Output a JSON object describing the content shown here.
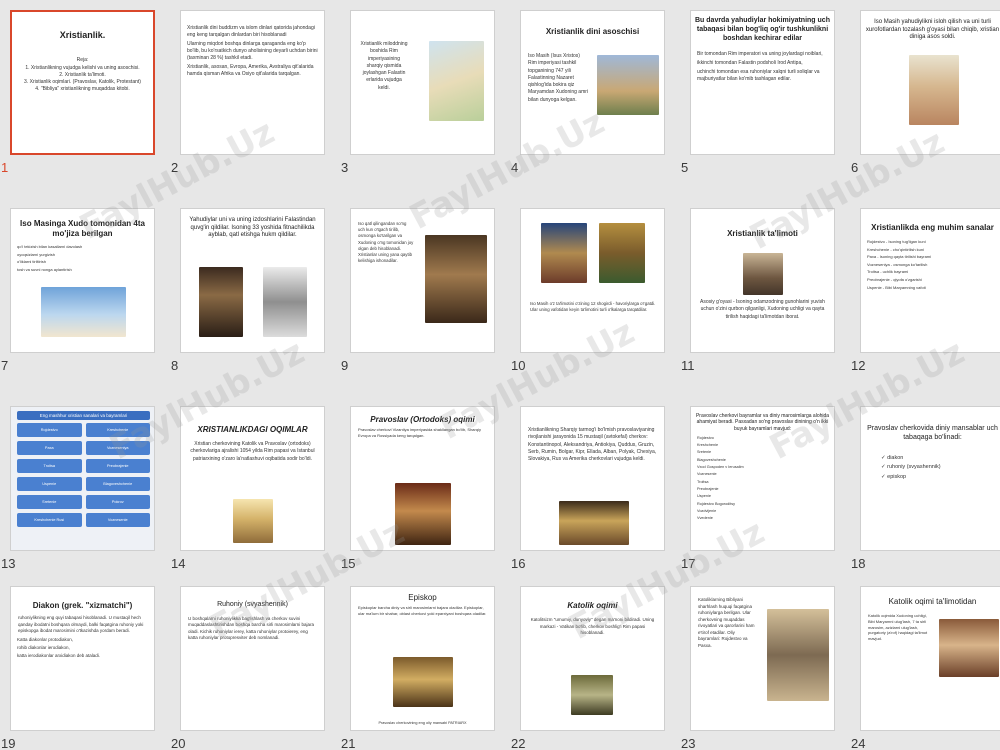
{
  "watermark": "FaylHub.Uz",
  "slides": [
    {
      "num": "1",
      "title": "Xristianlik.",
      "text": "Reja:\n1. Xristianlikning vujudga kelishi va uning asoschisi.\n2. Xristianlik ta'limoti.\n3. Xristianlik oqimlari. (Pravoslav, Katolik, Protestant)\n4. \"Bibliya\" xristianlikning muqaddas kitobi."
    },
    {
      "num": "2",
      "bullets": [
        "Xristianlik dini buddizm va islom dinlari qatorida jahondagi eng keng tarqalgan dinlardan biri hisoblanadi",
        "Ularning miqdori boshqa dinlarga qaraganda eng ko'p bo'lib, bu ko'rsatkich dunyo aholisining deyarli uchdan birini (taxminan 28 %) tashkil etadi.",
        "Xristianlik, asosan, Evropa, Amerika, Avstraliya qit'alarida hamda qisman Afrika va Osiyo qit'alarida tarqalgan."
      ]
    },
    {
      "num": "3",
      "text": "Xristianlik miloddning boshida Rim imperiyasining sharqiy qismida joylashgan Falastin erlarida vujudga keldi."
    },
    {
      "num": "4",
      "title": "Xristianlik dini asoschisi",
      "text": "Iso Masih (Isus Xristos) Rim imperiyasi tashkil topganining 747 yili Falastinning Nazaret qishlog'ida bokira qiz Maryamdan Xudoning amri bilan dunyoga kelgan."
    },
    {
      "num": "5",
      "title": "Bu davrda yahudiylar hokimiyatning uch tabaqasi bilan bog'liq og'ir tushkunlikni boshdan kechirar edilar",
      "bullets": [
        "Bir tomondan Rim imperatori va uning joylardagi noiblari,",
        "ikkinchi tomondan Falastin podsholi Irod Antipa,",
        "uchinchi tomondan esa ruhoniylar xalqni turli soliqlar va majburiyatlar bilan ko'mib tashlagan edilar."
      ]
    },
    {
      "num": "6",
      "title": "Iso Masih yahudiylikni isloh qilish va uni turli xurofotlardan tozalash g'oyasi bilan chiqib, xristian diniga asos soldi."
    },
    {
      "num": "7",
      "title": "Iso Masinga Xudo tomonidan 4ta mo'jiza berilgan",
      "bullets": [
        "qo'l tekizish bilan kasallarni davolash",
        "oyoqsizlarni yurgizish",
        "o'liklarni tiriltirish",
        "tosh va suvni nonga aylantirish"
      ]
    },
    {
      "num": "8",
      "title": "Yahudiylar uni va uning izdoshlarini Falastindan quvg'in qildilar. Isoning 33 yoshida fitnachilikda ayblab, qatl etishga hukm qildilar."
    },
    {
      "num": "9",
      "text": "Iso qatl qilingandan so'ng uch kun o'tgach tirilib, osmonga ko'tarilgan va Xudoning o'ng tomonidan joy olgan deb hisoblanadi. Xristianlar uning yana qaytib kelishiga ishonadilar."
    },
    {
      "num": "10",
      "text": "Iso Masih o'z ta'limotini o'zining 12 shogirdi - havoriylarga o'rgatdi. Ular uning vafotidan keyin ta'limotini turli o'lkalarga tarqatdilar."
    },
    {
      "num": "11",
      "title": "Xristianlik ta'limoti",
      "text": "Asosiy g'oyasi - Isoning odamzodning gunohlarini yuvish uchun o'zini qurbon qilganligi, Xudoning uchligi va qayta tirilish haqidagi ta'limotdan iborat."
    },
    {
      "num": "12",
      "title": "Xristianlikda eng muhim sanalar",
      "bullets": [
        "Rojdestvo - Isoning tug'ilgan kuni",
        "Kreshchenie - cho'qintirilish kuni",
        "Paxa - Isoning qayta tirilishi bayrami",
        "Vozneseniya - osmonga ko'tarilish",
        "Troitsa - uchlik bayrami",
        "Preobrajenie - qiyofa o'zgarishi",
        "Uspenie - Bibi Maryamning vafoti"
      ]
    },
    {
      "num": "13",
      "title": "Eng mashhur xristian sanalari va bayramlari",
      "boxes": [
        "Rojdestvo",
        "Kreshchenie",
        "Paxa",
        "Vozneseniya",
        "Troitsa",
        "Preobrajenie",
        "Uspenie",
        "Blagoveshchenie",
        "Sretenie",
        "Pokrov",
        "Kreshchenie Rusi",
        "Voznesenie"
      ]
    },
    {
      "num": "14",
      "title": "XRISTIANLIKDAGI OQIMLAR",
      "text": "Xristian cherkovining Katolik va Pravoslav (ortodoks) cherkovlariga ajralishi 1054 yilda Rim papasi va Istanbul patriarxining o'zaro la'natlashuvi oqibatida sodir bo'ldi."
    },
    {
      "num": "15",
      "title": "Pravoslav (Ortodoks) oqimi",
      "text": "Pravoslav cherkovi Vizantiya imperiyasida shakllangan bo'lib, Sharqiy Evropa va Rossiyada keng tarqalgan."
    },
    {
      "num": "16",
      "text": "Xristianlikning Sharqiy tarmog'i bo'lmish pravoslaviyaning rivojlanishi jarayonida 15 mustaqil (avtokefal) cherkov: Konstantinopol, Aleksandriya, Antiokiya, Quddus, Gruzin, Serb, Rumin, Bolgar, Kipr, Ellada, Alban, Polyak, Chexiya, Slovakiya, Rus va Amerika cherkovlari vujudga keldi."
    },
    {
      "num": "17",
      "title": "Pravoslav cherkovi bayramlar va diniy marosimlarga alohida ahamiyat beradi. Pasxadan so'ng pravoslav dinining o'n ikki buyuk bayramlari mavjud:",
      "bullets": [
        "Rojdestvo",
        "Kreshchenie",
        "Sretenie",
        "Blagoveshchenie",
        "Vxod Gospoden v Ierusalim",
        "Voznesenie",
        "Troitsa",
        "Preobrajenie",
        "Uspenie",
        "Rojdestvo Bogoroditsy",
        "Vozdvijenie",
        "Vvedenie"
      ]
    },
    {
      "num": "18",
      "title": "Pravoslav cherkovida diniy mansablar uch tabaqaga bo'linadi:",
      "checks": [
        "diakon",
        "ruhoniy (svyashennik)",
        "episkop"
      ]
    },
    {
      "num": "19",
      "title": "Diakon (grek. \"xizmatchi\")",
      "text": "ruhoniylikning eng quyi tabaqasi hisoblanadi. U mustaqil hech qanday ibodatni boshqara olmaydi, balki faqatgina ruhoniy yoki episkopga ibodat marosimini o'tkazishda yordam beradi.",
      "bullets": [
        "Katta diakonlar protodiakon,",
        "rohib diakonlar ierodiakon,",
        "katta ierodiakonlar arxidiakon deb ataladi."
      ]
    },
    {
      "num": "20",
      "title": "Ruhoniy (svyashennik)",
      "text": "U boshqalarni ruhoniylikka bag'ishlash va cherkov suvini muqaddaslashtirishdan boshqa barcha sirli marosimlarni bajara oladi. Kichik ruhoniylar ierey, katta ruhoniylar protoierey, eng katta ruhoniylar protopresviter deb nomlanadi."
    },
    {
      "num": "21",
      "title": "Episkop",
      "text": "Episkoplar barcha diniy va sirli marosimlarni bajara oladilar. Episkoplar, ular ma'lum bir shahar, oblast cherkovi yoki eparxiyani boshqara oladilar.",
      "caption": "Pravoslav cherkovining eng oliy mansabi PATRIARX"
    },
    {
      "num": "22",
      "title": "Katolik oqimi",
      "text": "Katolitsizm \"umumiy, dunyoviy\" degan ma'noni bildiradi. Uning markazi - Vatikan bo'lib, cherkov boshlig'i Rim papasi hisoblanadi."
    },
    {
      "num": "23",
      "text": "Katoliklarning Bibliyani sharhlash huquqi faqatgina ruhoniylarga berilgan. Ular cherkovning muqaddas rivoyatlari va qarorlarini ham e'tirof etadilar. Oliy bayramlari: Rojdestvo va Pasxa."
    },
    {
      "num": "24",
      "title": "Katolik oqimi ta'limotidan",
      "text": "Katolik oqimida Xudoning uchligi, Bibi Maryamni ulug'lash, 7 ta sirli marosim, azizlarni ulug'lash, purgatoriy (a'rof) haqidagi ta'limot mavjud."
    }
  ]
}
